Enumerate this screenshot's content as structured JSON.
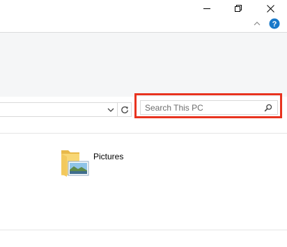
{
  "window": {
    "minimize_icon": "minimize-icon",
    "restore_icon": "restore-icon",
    "close_icon": "close-icon"
  },
  "ribbon_controls": {
    "expand_icon": "chevron-up-icon",
    "help_icon": "help-icon"
  },
  "address_bar": {
    "value": "",
    "dropdown_icon": "chevron-down-icon",
    "refresh_icon": "refresh-icon"
  },
  "search": {
    "placeholder": "Search This PC",
    "icon": "search-icon"
  },
  "content": {
    "items": [
      {
        "label": "Pictures",
        "icon": "pictures-folder-icon"
      }
    ]
  },
  "colors": {
    "highlight": "#e8331f",
    "help": "#1979ca",
    "ribbon_bg": "#f5f6f7"
  }
}
